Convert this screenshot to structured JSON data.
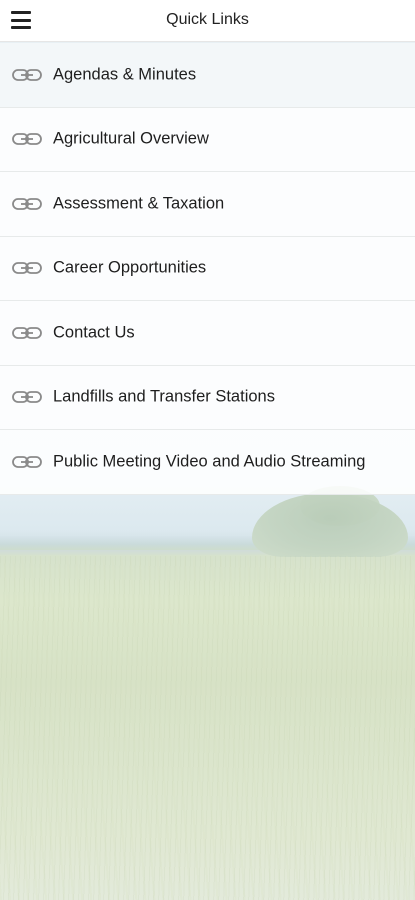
{
  "header": {
    "title": "Quick Links",
    "menu_icon": "hamburger-menu-icon"
  },
  "links": [
    {
      "label": "Agendas & Minutes",
      "icon": "link-icon"
    },
    {
      "label": "Agricultural Overview",
      "icon": "link-icon"
    },
    {
      "label": "Assessment & Taxation",
      "icon": "link-icon"
    },
    {
      "label": "Career Opportunities",
      "icon": "link-icon"
    },
    {
      "label": "Contact Us",
      "icon": "link-icon"
    },
    {
      "label": "Landfills and Transfer Stations",
      "icon": "link-icon"
    },
    {
      "label": "Public Meeting Video and Audio Streaming",
      "icon": "link-icon"
    }
  ],
  "colors": {
    "header_bg": "#ffffff",
    "text": "#1e1e1e",
    "icon": "#8a8a8a"
  }
}
